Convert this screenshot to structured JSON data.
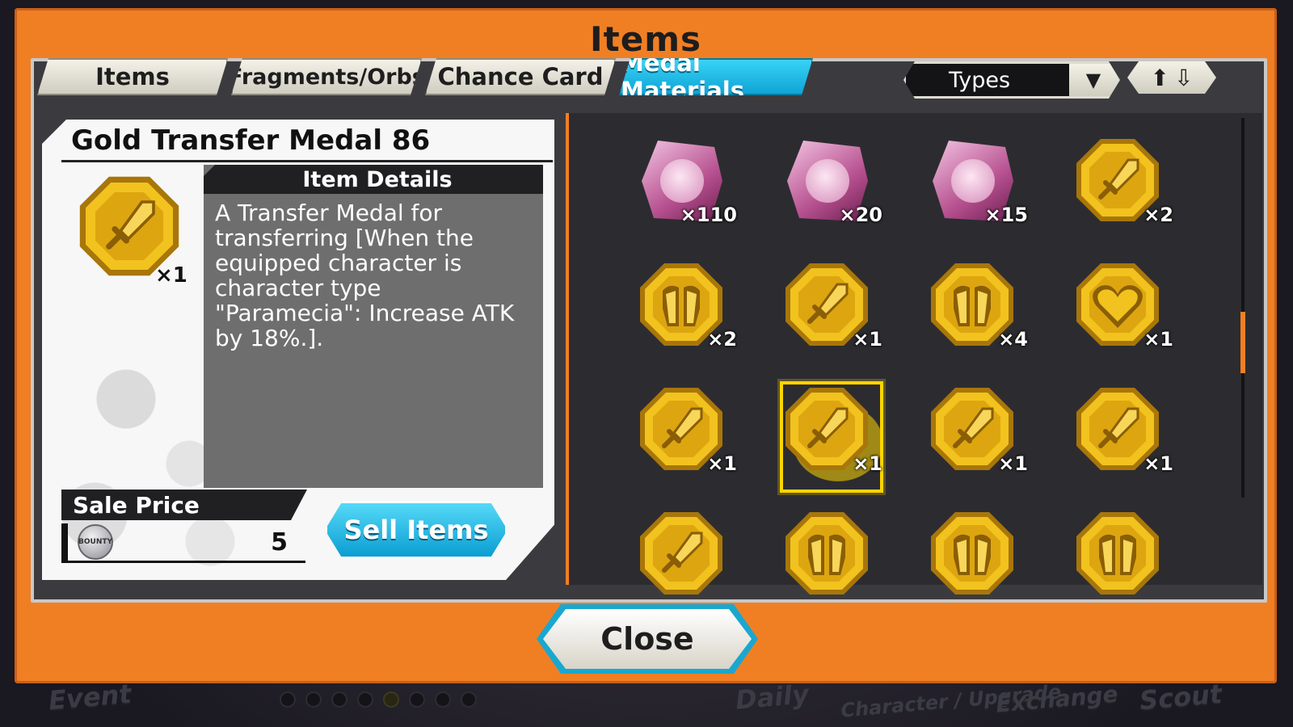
{
  "background_nav": [
    "Event",
    "Daily",
    "Character / Upgrade",
    "Exchange",
    "Scout"
  ],
  "dialog": {
    "title": "Items",
    "close_label": "Close"
  },
  "tabs": [
    {
      "label": "Items",
      "active": false
    },
    {
      "label": "Fragments/Orbs",
      "active": false
    },
    {
      "label": "Chance Card",
      "active": false
    },
    {
      "label": "Medal Materials",
      "active": true
    }
  ],
  "filter": {
    "types_label": "Types",
    "sort_icon": "sort-up-down-icon"
  },
  "detail": {
    "name": "Gold Transfer Medal 86",
    "icon": "sword-medal-icon",
    "quantity": "×1",
    "details_heading": "Item Details",
    "description": "A Transfer Medal for transferring [When the equipped character is character type \"Paramecia\": Increase ATK by 18%.].",
    "sale_price_label": "Sale Price",
    "currency_icon": "bounty-coin-icon",
    "sale_price_value": "5",
    "sell_button": "Sell Items"
  },
  "grid": [
    {
      "kind": "character",
      "icon": "character-medal-icon",
      "qty": "×110"
    },
    {
      "kind": "character",
      "icon": "character-medal-icon",
      "qty": "×20"
    },
    {
      "kind": "character",
      "icon": "character-medal-icon",
      "qty": "×15"
    },
    {
      "kind": "gold",
      "icon": "sword-medal-icon",
      "qty": "×2"
    },
    {
      "kind": "gold",
      "icon": "armor-medal-icon",
      "qty": "×2"
    },
    {
      "kind": "gold",
      "icon": "sword-medal-icon",
      "qty": "×1"
    },
    {
      "kind": "gold",
      "icon": "armor-medal-icon",
      "qty": "×4"
    },
    {
      "kind": "gold",
      "icon": "heart-medal-icon",
      "qty": "×1"
    },
    {
      "kind": "gold",
      "icon": "sword-medal-icon",
      "qty": "×1"
    },
    {
      "kind": "gold",
      "icon": "sword-medal-icon",
      "qty": "×1",
      "selected": true
    },
    {
      "kind": "gold",
      "icon": "sword-medal-icon",
      "qty": "×1"
    },
    {
      "kind": "gold",
      "icon": "sword-medal-icon",
      "qty": "×1"
    },
    {
      "kind": "gold",
      "icon": "sword-medal-icon",
      "qty": ""
    },
    {
      "kind": "gold",
      "icon": "armor-medal-icon",
      "qty": ""
    },
    {
      "kind": "gold",
      "icon": "armor-medal-icon",
      "qty": ""
    },
    {
      "kind": "gold",
      "icon": "armor-medal-icon",
      "qty": ""
    }
  ],
  "colors": {
    "frame": "#f07f24",
    "accent": "#0fa4d6",
    "highlight": "#ffd400",
    "medal": "#e6b417"
  }
}
